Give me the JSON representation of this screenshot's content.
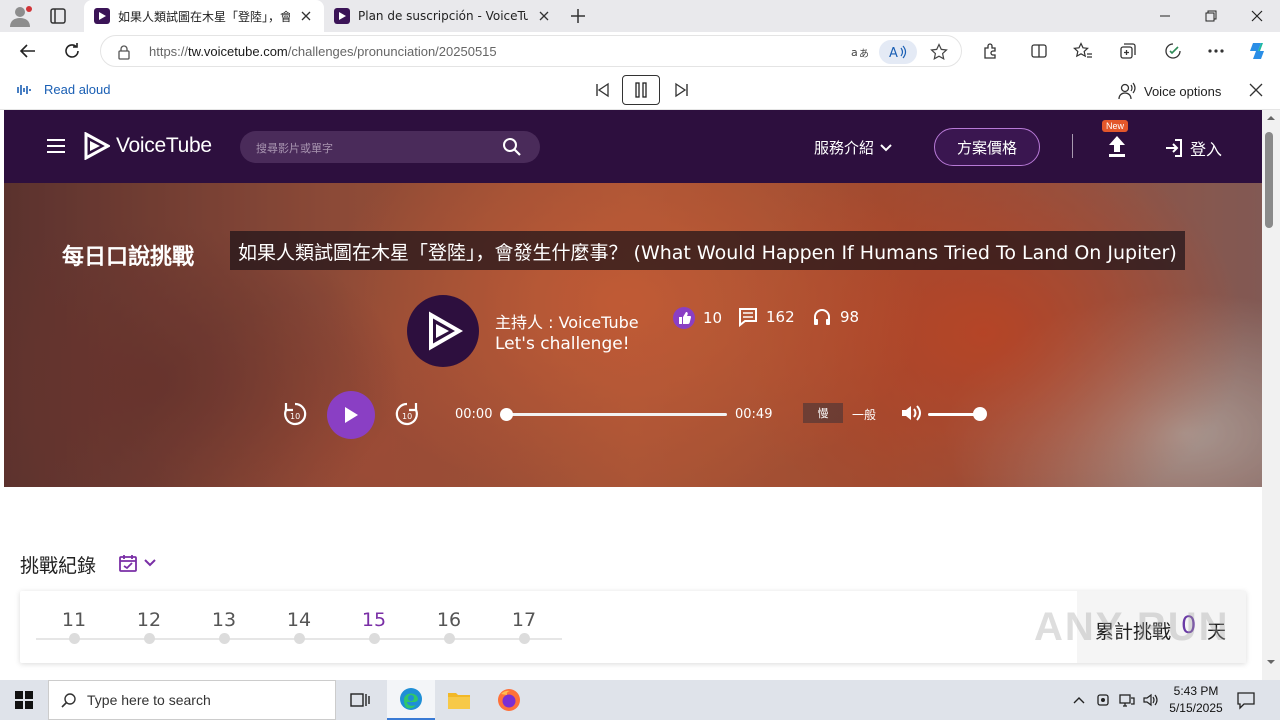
{
  "browser": {
    "tabs": [
      {
        "title": "如果人類試圖在木星「登陸」，會發生什麼事？",
        "active": true
      },
      {
        "title": "Plan de suscripción - VoiceTube /",
        "active": false
      }
    ],
    "url_prefix": "https://",
    "url_domain": "tw.voicetube.com",
    "url_path": "/challenges/pronunciation/20250515"
  },
  "read_aloud": {
    "label": "Read aloud",
    "voice_options": "Voice options"
  },
  "site": {
    "logo_text": "VoiceTube",
    "search_placeholder": "搜尋影片或單字",
    "services_label": "服務介紹",
    "plan_label": "方案價格",
    "new_badge": "New",
    "login_label": "登入"
  },
  "hero": {
    "section_title": "每日口說挑戰",
    "video_title": "如果人類試圖在木星「登陸」，會發生什麼事？ (What Would Happen If Humans Tried To Land On Jupiter)",
    "host": "主持人 : VoiceTube",
    "tagline": "Let's challenge!",
    "likes": "10",
    "comments": "162",
    "listens": "98",
    "current_time": "00:00",
    "duration": "00:49",
    "progress_fraction": 0,
    "speed_slow": "慢",
    "speed_normal": "一般",
    "volume_fraction": 1
  },
  "record": {
    "title": "挑戰紀錄",
    "days": [
      "11",
      "12",
      "13",
      "14",
      "15",
      "16",
      "17"
    ],
    "current_day": "15",
    "streak_label": "累計挑戰",
    "streak_value": "0",
    "streak_unit": "天"
  },
  "watermark": "ANY RUN",
  "taskbar": {
    "search_placeholder": "Type here to search",
    "time": "5:43 PM",
    "date": "5/15/2025"
  },
  "colors": {
    "brand_dark": "#2d0f3e",
    "brand_purple": "#8a3fc4",
    "accent_link": "#1a5fb4"
  }
}
